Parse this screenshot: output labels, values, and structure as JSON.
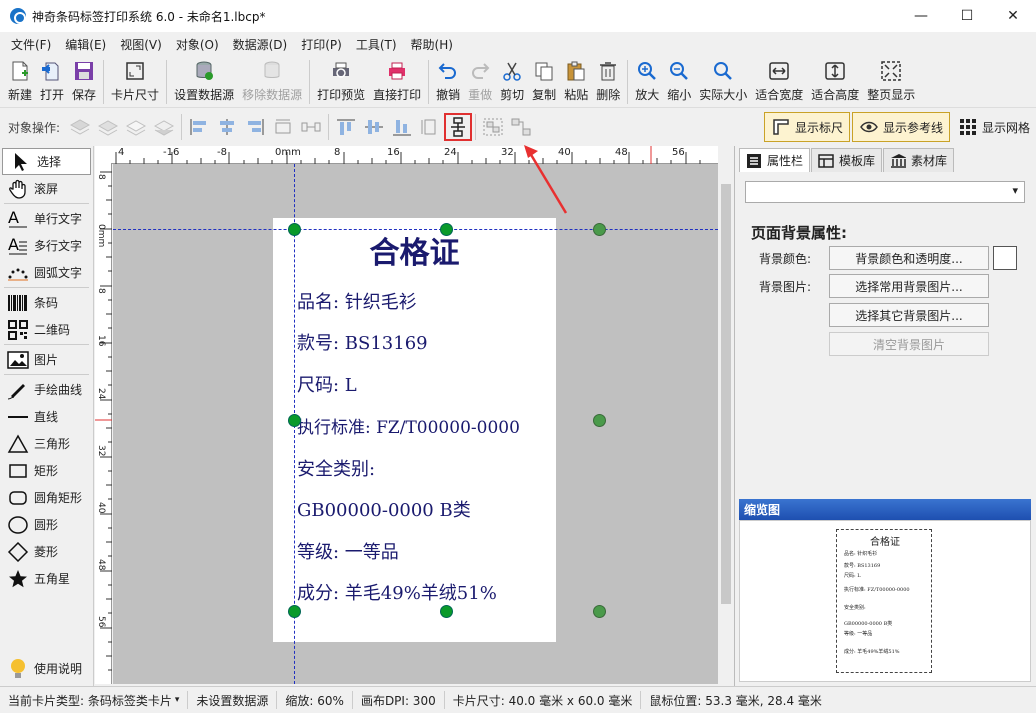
{
  "window": {
    "title": "神奇条码标签打印系统 6.0 - 未命名1.lbcp*",
    "minimize": "—",
    "maximize": "☐",
    "close": "✕"
  },
  "menu": [
    "文件(F)",
    "编辑(E)",
    "视图(V)",
    "对象(O)",
    "数据源(D)",
    "打印(P)",
    "工具(T)",
    "帮助(H)"
  ],
  "toolbar": {
    "new": "新建",
    "open": "打开",
    "save": "保存",
    "card_size": "卡片尺寸",
    "set_datasource": "设置数据源",
    "remove_datasource": "移除数据源",
    "print_preview": "打印预览",
    "direct_print": "直接打印",
    "undo": "撤销",
    "redo": "重做",
    "cut": "剪切",
    "copy": "复制",
    "paste": "粘贴",
    "delete": "删除",
    "zoom_in": "放大",
    "zoom_out": "缩小",
    "actual_size": "实际大小",
    "fit_width": "适合宽度",
    "fit_height": "适合高度",
    "fit_page": "整页显示"
  },
  "objbar": {
    "label": "对象操作:",
    "show_ruler": "显示标尺",
    "show_guides": "显示参考线",
    "show_grid": "显示网格"
  },
  "tools": [
    "选择",
    "滚屏",
    "单行文字",
    "多行文字",
    "圆弧文字",
    "条码",
    "二维码",
    "图片",
    "手绘曲线",
    "直线",
    "三角形",
    "矩形",
    "圆角矩形",
    "圆形",
    "菱形",
    "五角星",
    "使用说明"
  ],
  "ruler": {
    "h_labels": [
      "4",
      "-16",
      "-8",
      "0mm",
      "8",
      "16",
      "24",
      "32",
      "40",
      "48",
      "56"
    ],
    "v_labels": [
      "8",
      "0mm",
      "8",
      "16",
      "24",
      "32",
      "40",
      "48",
      "56"
    ]
  },
  "label": {
    "title": "合格证",
    "lines": [
      "品名: 针织毛衫",
      "款号: BS13169",
      "尺码: L",
      "执行标准: FZ/T00000-0000",
      "安全类别:",
      "GB00000-0000 B类",
      "等级: 一等品",
      "成分: 羊毛49%羊绒51%"
    ]
  },
  "right_panel": {
    "tabs": [
      "属性栏",
      "模板库",
      "素材库"
    ],
    "section_title": "页面背景属性:",
    "bg_color_label": "背景颜色:",
    "bg_color_button": "背景颜色和透明度...",
    "bg_image_label": "背景图片:",
    "choose_common_bg": "选择常用背景图片...",
    "choose_other_bg": "选择其它背景图片...",
    "clear_bg": "清空背景图片",
    "preview_header": "缩览图"
  },
  "status": {
    "card_type": "当前卡片类型: 条码标签类卡片",
    "datasource": "未设置数据源",
    "zoom": "缩放: 60%",
    "dpi": "画布DPI: 300",
    "card_size": "卡片尺寸: 40.0 毫米 x 60.0 毫米",
    "mouse_pos": "鼠标位置: 53.3 毫米, 28.4 毫米"
  },
  "colors": {
    "label_text": "#1a1a6e",
    "handle": "#0a9a2a",
    "guide": "#2030c0",
    "highlight": "#e03030",
    "preview_header": "#1e4fb0"
  }
}
